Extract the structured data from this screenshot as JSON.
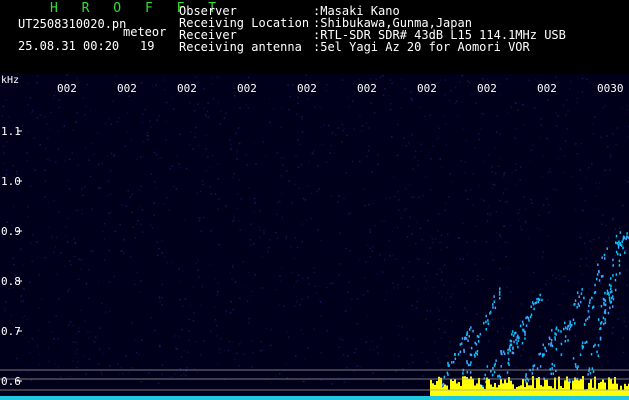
{
  "header": {
    "title": "H R O F F T",
    "filename": "UT2508310020.pn",
    "meteor_label": "meteor",
    "datetime": "25.08.31 00:20",
    "count": "19",
    "info": [
      {
        "label": "Observer",
        "value": ":Masaki Kano"
      },
      {
        "label": "Receiving Location",
        "value": ":Shibukawa,Gunma,Japan"
      },
      {
        "label": "Receiver",
        "value": ":RTL-SDR SDR# 43dB L15 114.1MHz USB"
      },
      {
        "label": "Receiving antenna",
        "value": ":5el Yagi Az 20 for Aomori VOR"
      }
    ]
  },
  "spectrogram": {
    "y_unit": "kHz",
    "y_ticks": [
      "1.1",
      "1.0",
      "0.9",
      "0.8",
      "0.7",
      "0.6"
    ],
    "x_ticks": [
      "002",
      "002",
      "002",
      "002",
      "002",
      "002",
      "002",
      "002",
      "002",
      "0030"
    ],
    "colors": {
      "background": "#00001a",
      "noise": "#1a2d8a",
      "signal": "#00c8ff",
      "baseline": "#ffff00",
      "grid": "#a0a0a0",
      "text": "#ffffff"
    }
  }
}
